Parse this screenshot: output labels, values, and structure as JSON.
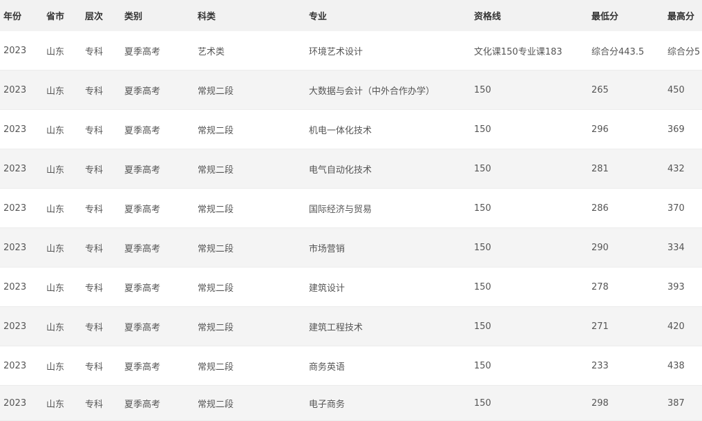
{
  "table": {
    "headers": [
      "年份",
      "省市",
      "层次",
      "类别",
      "科类",
      "专业",
      "资格线",
      "最低分",
      "最高分"
    ],
    "rows": [
      [
        "2023",
        "山东",
        "专科",
        "夏季高考",
        "艺术类",
        "环境艺术设计",
        "文化课150专业课183",
        "综合分443.5",
        "综合分5"
      ],
      [
        "2023",
        "山东",
        "专科",
        "夏季高考",
        "常规二段",
        "大数据与会计（中外合作办学）",
        "150",
        "265",
        "450"
      ],
      [
        "2023",
        "山东",
        "专科",
        "夏季高考",
        "常规二段",
        "机电一体化技术",
        "150",
        "296",
        "369"
      ],
      [
        "2023",
        "山东",
        "专科",
        "夏季高考",
        "常规二段",
        "电气自动化技术",
        "150",
        "281",
        "432"
      ],
      [
        "2023",
        "山东",
        "专科",
        "夏季高考",
        "常规二段",
        "国际经济与贸易",
        "150",
        "286",
        "370"
      ],
      [
        "2023",
        "山东",
        "专科",
        "夏季高考",
        "常规二段",
        "市场营销",
        "150",
        "290",
        "334"
      ],
      [
        "2023",
        "山东",
        "专科",
        "夏季高考",
        "常规二段",
        "建筑设计",
        "150",
        "278",
        "393"
      ],
      [
        "2023",
        "山东",
        "专科",
        "夏季高考",
        "常规二段",
        "建筑工程技术",
        "150",
        "271",
        "420"
      ],
      [
        "2023",
        "山东",
        "专科",
        "夏季高考",
        "常规二段",
        "商务英语",
        "150",
        "233",
        "438"
      ],
      [
        "2023",
        "山东",
        "专科",
        "夏季高考",
        "常规二段",
        "电子商务",
        "150",
        "298",
        "387"
      ]
    ]
  }
}
